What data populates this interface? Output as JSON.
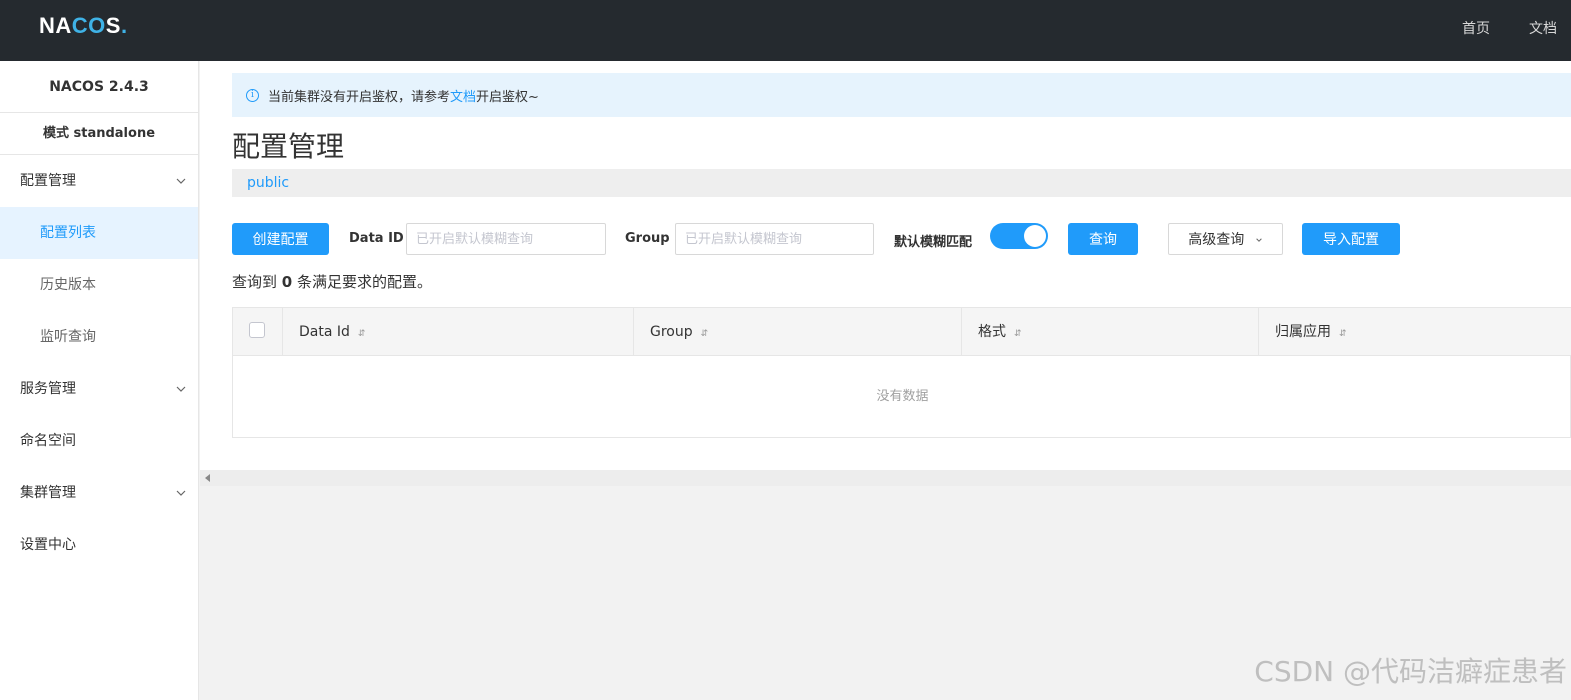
{
  "header": {
    "logo": {
      "part1": "NA",
      "part2": "CO",
      "part3": "S",
      "dot": "."
    },
    "nav": {
      "home": "首页",
      "docs": "文档"
    }
  },
  "sidebar": {
    "version": "NACOS 2.4.3",
    "mode": "模式 standalone",
    "items": [
      {
        "label": "配置管理",
        "icon": "chevron-down-icon"
      },
      {
        "label": "配置列表"
      },
      {
        "label": "历史版本"
      },
      {
        "label": "监听查询"
      },
      {
        "label": "服务管理",
        "icon": "chevron-down-icon"
      },
      {
        "label": "命名空间"
      },
      {
        "label": "集群管理",
        "icon": "chevron-down-icon"
      },
      {
        "label": "设置中心"
      }
    ]
  },
  "alert": {
    "text_before": "当前集群没有开启鉴权，请参考",
    "link": "文档",
    "text_after": "开启鉴权~"
  },
  "page": {
    "title": "配置管理",
    "namespace": "public"
  },
  "toolbar": {
    "create_label": "创建配置",
    "data_id_label": "Data ID",
    "data_id_placeholder": "已开启默认模糊查询",
    "group_label": "Group",
    "group_placeholder": "已开启默认模糊查询",
    "fuzzy_label": "默认模糊匹配",
    "fuzzy_enabled": true,
    "query_label": "查询",
    "advanced_label": "高级查询",
    "import_label": "导入配置"
  },
  "result": {
    "prefix": "查询到",
    "count": "0",
    "suffix": "条满足要求的配置。"
  },
  "table": {
    "columns": [
      "Data Id",
      "Group",
      "格式",
      "归属应用"
    ],
    "empty_text": "没有数据"
  },
  "watermark": "CSDN @代码洁癖症患者",
  "colors": {
    "primary": "#209bfa",
    "topbar": "#252a2f",
    "active_bg": "#e6f3ff",
    "alert_bg": "#e6f3fd"
  }
}
